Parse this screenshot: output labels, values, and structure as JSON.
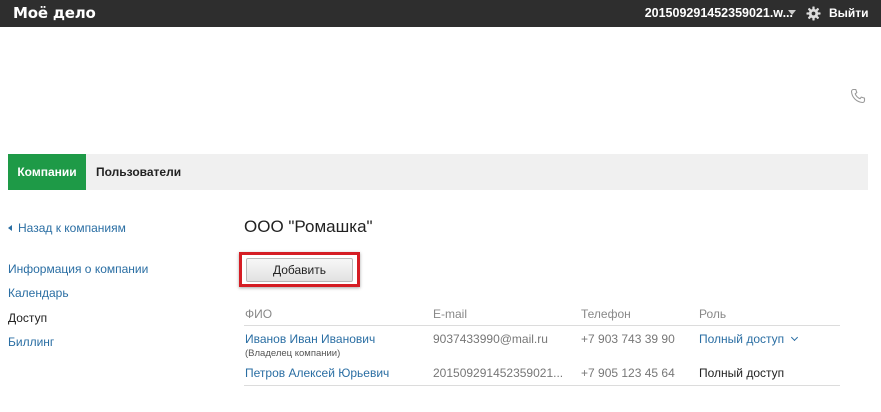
{
  "topbar": {
    "logo": "Моё дело",
    "account": "20150929145235902​1.w...",
    "logout": "Выйти"
  },
  "tabs": {
    "active": "Компании",
    "other": "Пользователи"
  },
  "sidebar": {
    "back": "Назад к компаниям",
    "items": [
      {
        "label": "Информация о компании"
      },
      {
        "label": "Календарь"
      },
      {
        "label": "Доступ"
      },
      {
        "label": "Биллинг"
      }
    ]
  },
  "main": {
    "company": "ООО \"Ромашка\"",
    "add_button": "Добавить",
    "columns": [
      "ФИО",
      "E-mail",
      "Телефон",
      "Роль"
    ],
    "rows": [
      {
        "name": "Иванов Иван Иванович",
        "note": "(Владелец компании)",
        "email": "9037433990@mail.ru",
        "phone": "+7 903 743 39 90",
        "role": "Полный доступ"
      },
      {
        "name": "Петров Алексей Юрьевич",
        "email": "201509291452359021...",
        "phone": "+7 905 123 45 64",
        "role": "Полный доступ"
      }
    ]
  }
}
